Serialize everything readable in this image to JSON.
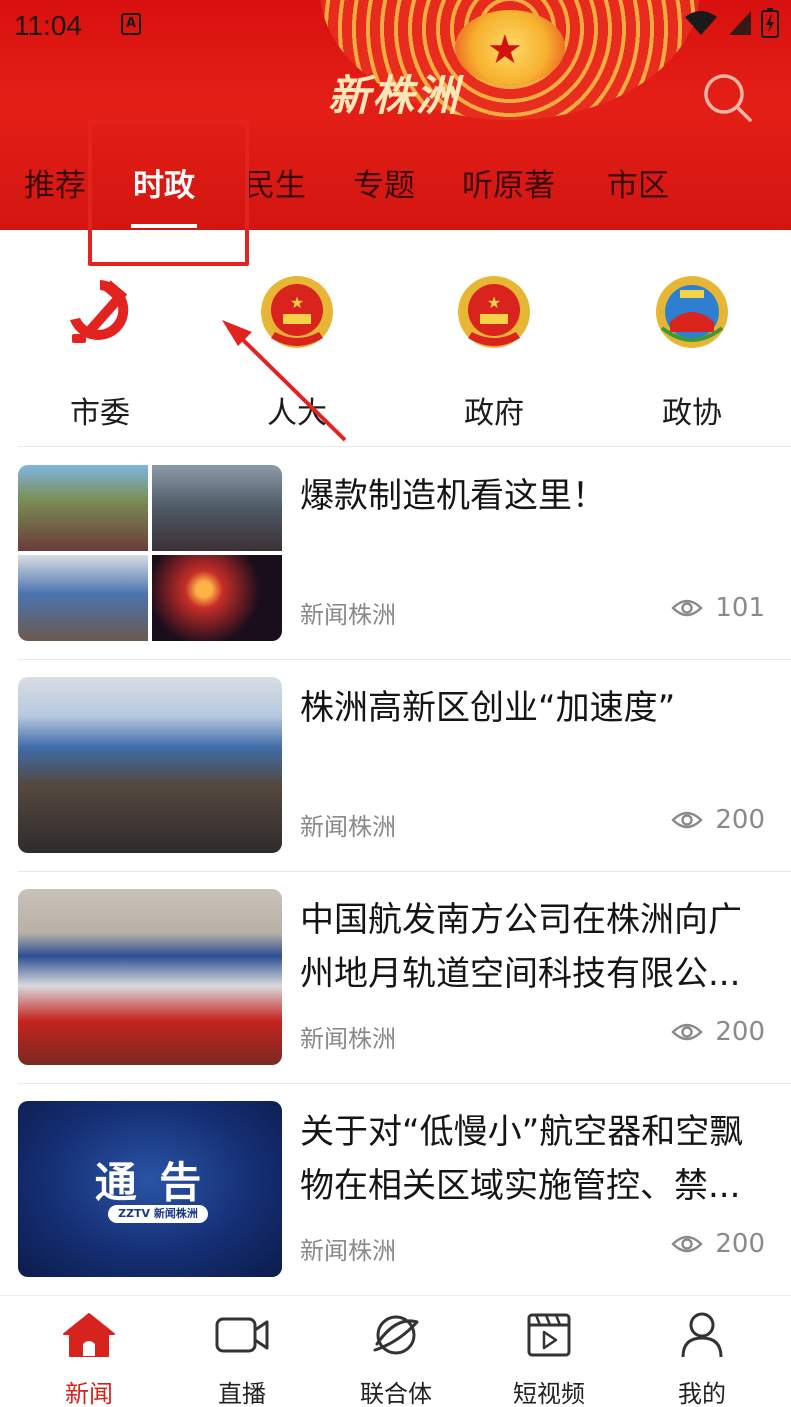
{
  "status_bar": {
    "time": "11:04",
    "app_badge": "A"
  },
  "header": {
    "logo": "新株洲"
  },
  "tabs": [
    {
      "label": "推荐"
    },
    {
      "label": "时政"
    },
    {
      "label": "民生"
    },
    {
      "label": "专题"
    },
    {
      "label": "听原著"
    },
    {
      "label": "市区"
    }
  ],
  "active_tab_index": 1,
  "categories": [
    {
      "label": "市委",
      "icon": "party-emblem-icon"
    },
    {
      "label": "人大",
      "icon": "national-emblem-icon"
    },
    {
      "label": "政府",
      "icon": "national-emblem-icon"
    },
    {
      "label": "政协",
      "icon": "cppcc-emblem-icon"
    }
  ],
  "news": [
    {
      "title": "爆款制造机看这里！",
      "source": "新闻株洲",
      "views": "101"
    },
    {
      "title": "株洲高新区创业“加速度”",
      "source": "新闻株洲",
      "views": "200"
    },
    {
      "title": "中国航发南方公司在株洲向广州地月轨道空间科技有限公...",
      "source": "新闻株洲",
      "views": "200"
    },
    {
      "title": "关于对“低慢小”航空器和空飘物在相关区域实施管控、禁...",
      "source": "新闻株洲",
      "views": "200",
      "thumb_text": "通 告",
      "thumb_sub": "ZZTV 新闻株洲"
    }
  ],
  "bottom_nav": [
    {
      "label": "新闻",
      "icon": "home-icon",
      "active": true
    },
    {
      "label": "直播",
      "icon": "video-camera-icon",
      "active": false
    },
    {
      "label": "联合体",
      "icon": "planet-icon",
      "active": false
    },
    {
      "label": "短视频",
      "icon": "clapperboard-icon",
      "active": false
    },
    {
      "label": "我的",
      "icon": "user-icon",
      "active": false
    }
  ],
  "colors": {
    "brand_red": "#d7231d",
    "header_red": "#e41f17",
    "annotation_red": "#e3231f"
  }
}
